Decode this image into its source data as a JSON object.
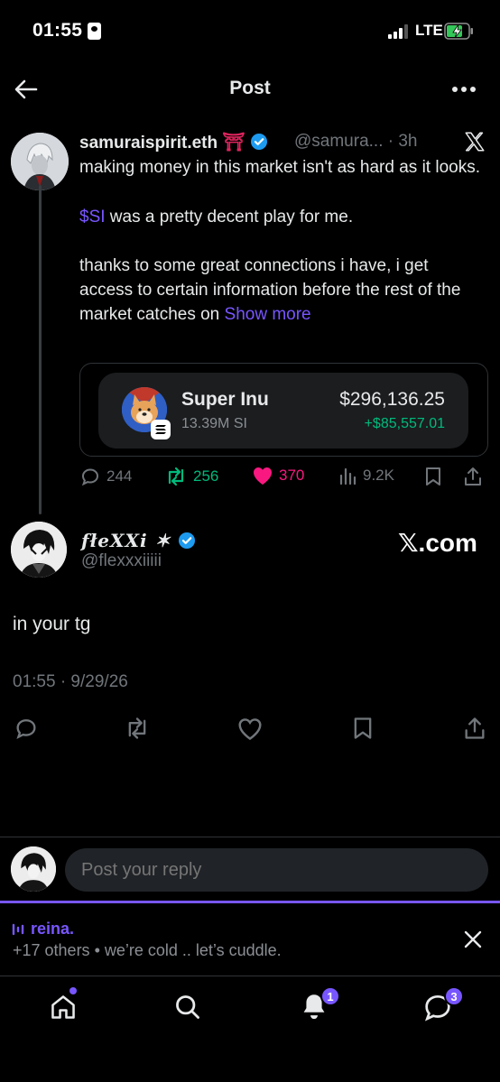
{
  "status_bar": {
    "time": "01:55",
    "network": "LTE"
  },
  "header": {
    "title": "Post"
  },
  "quoted_post": {
    "author_name": "samuraispirit.eth",
    "author_emoji": "⛩️",
    "handle_time": "@samura... · 3h",
    "text_line1": "making money in this market isn't as hard as it looks.",
    "cashtag": "$SI",
    "text_line2": " was a pretty decent play for me.",
    "text_line3": "thanks to some great connections i have, i get access to certain information before the rest of the market catches on ",
    "show_more": "Show more",
    "token": {
      "name": "Super Inu",
      "supply": "13.39M SI",
      "price": "$296,136.25",
      "change": "+$85,557.01"
    },
    "stats": {
      "replies": "244",
      "reposts": "256",
      "likes": "370",
      "views": "9.2K"
    },
    "colors": {
      "repost": "#00ba7c",
      "like": "#f91880",
      "muted": "#71767b"
    }
  },
  "main_post": {
    "author_name": "fłeXXi ✶",
    "handle": "@flexxxiiiii",
    "watermark": "𝕏.com",
    "text": "in your tg",
    "timestamp": "01:55 · 9/29/26"
  },
  "reply": {
    "placeholder": "Post your reply"
  },
  "space": {
    "host": "reina.",
    "subtitle": "+17 others • we’re cold .. let’s cuddle."
  },
  "tabbar": {
    "notifications_badge": "1",
    "messages_badge": "3"
  },
  "accent": "#7856ff"
}
